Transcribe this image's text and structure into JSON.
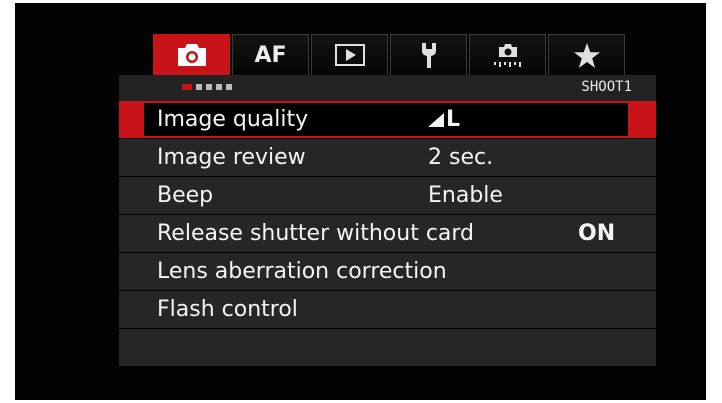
{
  "tabs": [
    {
      "id": "shoot",
      "icon": "camera-icon",
      "active": true
    },
    {
      "id": "af",
      "label": "AF"
    },
    {
      "id": "playback",
      "icon": "play-icon"
    },
    {
      "id": "setup",
      "icon": "wrench-icon"
    },
    {
      "id": "custom",
      "icon": "custom-functions-icon"
    },
    {
      "id": "mymenu",
      "icon": "star-icon"
    }
  ],
  "page": {
    "name": "SHOOT1",
    "dot_count": 5,
    "active_dot": 0
  },
  "items": [
    {
      "label": "Image quality",
      "value_icon": "large-fine-quality-icon",
      "value": "L",
      "selected": true
    },
    {
      "label": "Image review",
      "value": "2 sec."
    },
    {
      "label": "Beep",
      "value": "Enable"
    },
    {
      "label": "Release shutter without card",
      "value": "ON"
    },
    {
      "label": "Lens aberration correction",
      "value": ""
    },
    {
      "label": "Flash control",
      "value": ""
    },
    {
      "label": "",
      "value": ""
    }
  ],
  "colors": {
    "accent": "#c81318",
    "row": "#262626",
    "text": "#f4f4f4"
  }
}
